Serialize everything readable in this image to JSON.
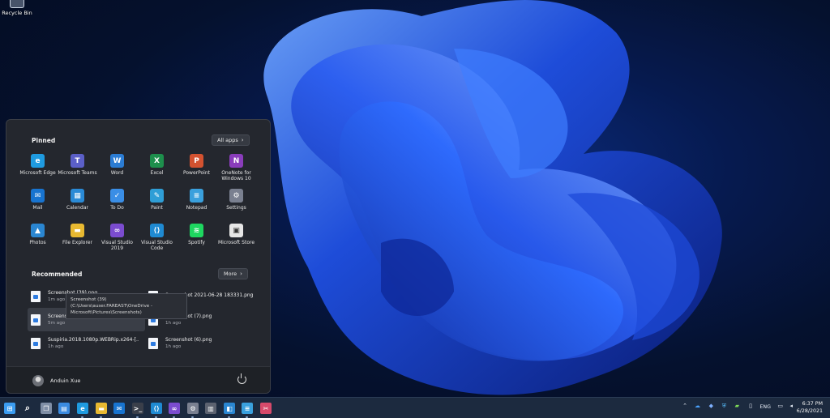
{
  "desktop": {
    "recycle_bin_label": "Recycle Bin"
  },
  "start_menu": {
    "pinned_heading": "Pinned",
    "all_apps_label": "All apps",
    "pinned_apps": [
      {
        "name": "Microsoft Edge",
        "icon": "edge-icon",
        "color": "#1f9be0"
      },
      {
        "name": "Microsoft Teams",
        "icon": "teams-icon",
        "color": "#5b5fc7"
      },
      {
        "name": "Word",
        "icon": "word-icon",
        "color": "#2b7cd3"
      },
      {
        "name": "Excel",
        "icon": "excel-icon",
        "color": "#1d8f4c"
      },
      {
        "name": "PowerPoint",
        "icon": "powerpoint-icon",
        "color": "#d35230"
      },
      {
        "name": "OneNote for Windows 10",
        "icon": "onenote-icon",
        "color": "#8a3dbb"
      },
      {
        "name": "Mail",
        "icon": "mail-icon",
        "color": "#1874d0"
      },
      {
        "name": "Calendar",
        "icon": "calendar-icon",
        "color": "#2a8ad6"
      },
      {
        "name": "To Do",
        "icon": "todo-icon",
        "color": "#3a8ee6"
      },
      {
        "name": "Paint",
        "icon": "paint-icon",
        "color": "#2f9ed6"
      },
      {
        "name": "Notepad",
        "icon": "notepad-icon",
        "color": "#3aa0dd"
      },
      {
        "name": "Settings",
        "icon": "settings-icon",
        "color": "#7a8090"
      },
      {
        "name": "Photos",
        "icon": "photos-icon",
        "color": "#2a86d1"
      },
      {
        "name": "File Explorer",
        "icon": "folder-icon",
        "color": "#e8b931"
      },
      {
        "name": "Visual Studio 2019",
        "icon": "visual-studio-icon",
        "color": "#7b4ccf"
      },
      {
        "name": "Visual Studio Code",
        "icon": "vscode-icon",
        "color": "#1f8ad2"
      },
      {
        "name": "Spotify",
        "icon": "spotify-icon",
        "color": "#1ed760"
      },
      {
        "name": "Microsoft Store",
        "icon": "store-icon",
        "color": "#e6e6e6"
      }
    ],
    "recommended_heading": "Recommended",
    "more_label": "More",
    "recommended": [
      {
        "name": "Screenshot (39).png",
        "time": "1m ago"
      },
      {
        "name": "Screenshot 2021-06-28 183331.png",
        "time": ""
      },
      {
        "name": "Screenshot (39).png",
        "time": "5m ago"
      },
      {
        "name": "Screenshot (7).png",
        "time": "1h ago"
      },
      {
        "name": "Suspiria.2018.1080p.WEBRip.x264-[...",
        "time": "1h ago"
      },
      {
        "name": "Screenshot (6).png",
        "time": "1h ago"
      }
    ],
    "tooltip_line1": "Screenshot (39) (C:\\Users\\auser.FAREAST\\OneDrive -",
    "tooltip_line2": "Microsoft\\Pictures\\Screenshots)",
    "user_name": "Anduin Xue"
  },
  "taskbar": {
    "language": "ENG",
    "time": "6:37 PM",
    "date": "6/28/2021",
    "apps": [
      {
        "name": "start-button",
        "icon": "windows-logo-icon",
        "color": "#3b9cf0"
      },
      {
        "name": "search-button",
        "icon": "search-icon",
        "color": "transparent"
      },
      {
        "name": "task-view-button",
        "icon": "task-view-icon",
        "color": "#7f8ea6"
      },
      {
        "name": "widgets-button",
        "icon": "widgets-icon",
        "color": "#3b8be0"
      },
      {
        "name": "edge-taskbar",
        "icon": "edge-icon",
        "color": "#1f9be0"
      },
      {
        "name": "file-explorer-taskbar",
        "icon": "folder-icon",
        "color": "#e8b931"
      },
      {
        "name": "mail-taskbar",
        "icon": "mail-icon",
        "color": "#1874d0"
      },
      {
        "name": "terminal-taskbar",
        "icon": "terminal-icon",
        "color": "#3a3f4a"
      },
      {
        "name": "vscode-taskbar",
        "icon": "vscode-icon",
        "color": "#1f8ad2"
      },
      {
        "name": "visual-studio-taskbar",
        "icon": "visual-studio-icon",
        "color": "#7b4ccf"
      },
      {
        "name": "settings-taskbar",
        "icon": "settings-icon",
        "color": "#7a8090"
      },
      {
        "name": "calculator-taskbar",
        "icon": "calculator-icon",
        "color": "#5c6270"
      },
      {
        "name": "remote-desktop-taskbar",
        "icon": "remote-desktop-icon",
        "color": "#2a86d1"
      },
      {
        "name": "notepad-taskbar",
        "icon": "notepad-icon",
        "color": "#3aa0dd"
      },
      {
        "name": "snip-tool-taskbar",
        "icon": "snip-icon",
        "color": "#d64a6b"
      }
    ]
  }
}
